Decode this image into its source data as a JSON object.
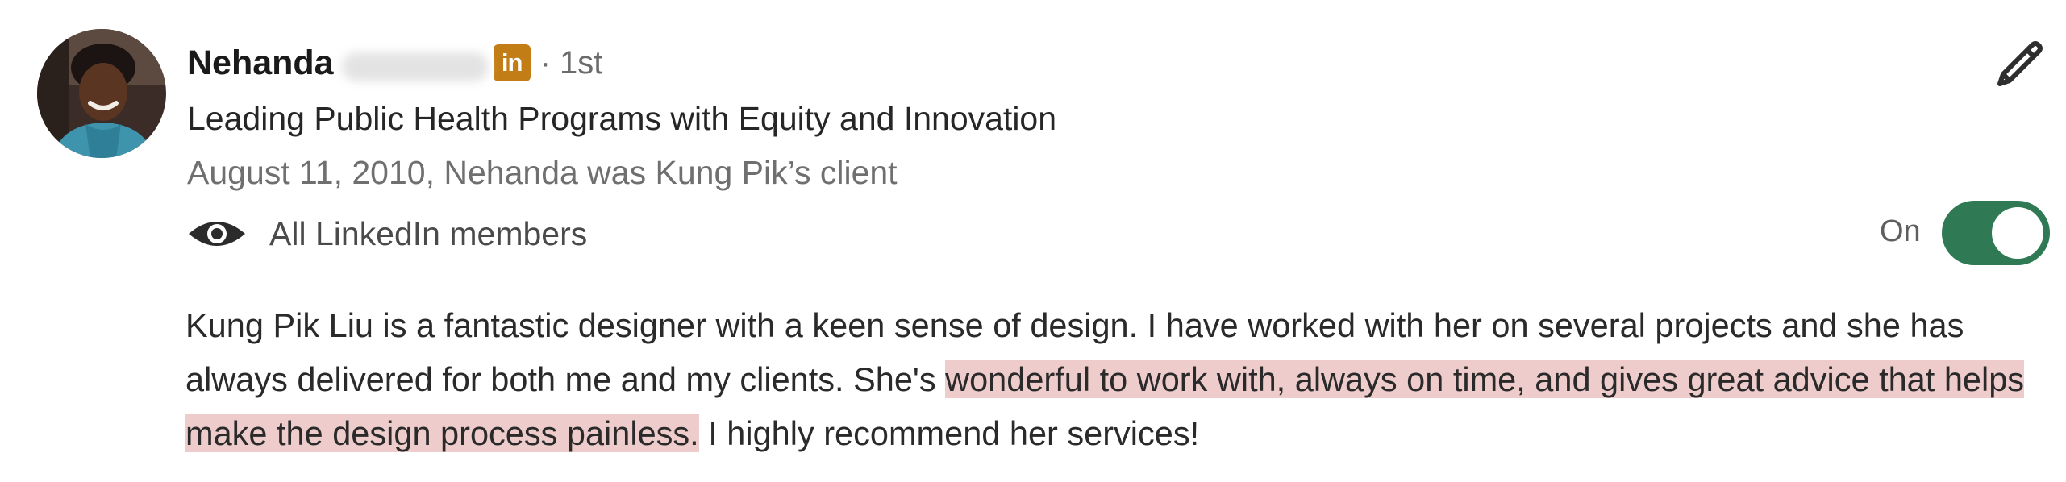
{
  "recommender": {
    "first_name": "Nehanda",
    "linkedin_badge": "in",
    "degree": "· 1st",
    "headline": "Leading Public Health Programs with Equity and Innovation",
    "meta": "August 11, 2010, Nehanda was Kung Pik’s client"
  },
  "visibility": {
    "icon": "eye-icon",
    "label": "All LinkedIn members",
    "toggle_label": "On",
    "toggle_on": true
  },
  "actions": {
    "edit_icon": "pencil-icon"
  },
  "recommendation": {
    "part1": "Kung Pik Liu is a fantastic designer with a keen sense of design. I have worked with her on several projects and she has always delivered for both me and my clients. She's ",
    "highlighted": "wonderful to work with, always on time, and gives great advice that helps make the design process painless.",
    "part2": " I highly recommend her services!"
  },
  "colors": {
    "toggle_on": "#2f7a55",
    "linkedin_badge": "#c37d16",
    "highlight": "#efcccc"
  }
}
